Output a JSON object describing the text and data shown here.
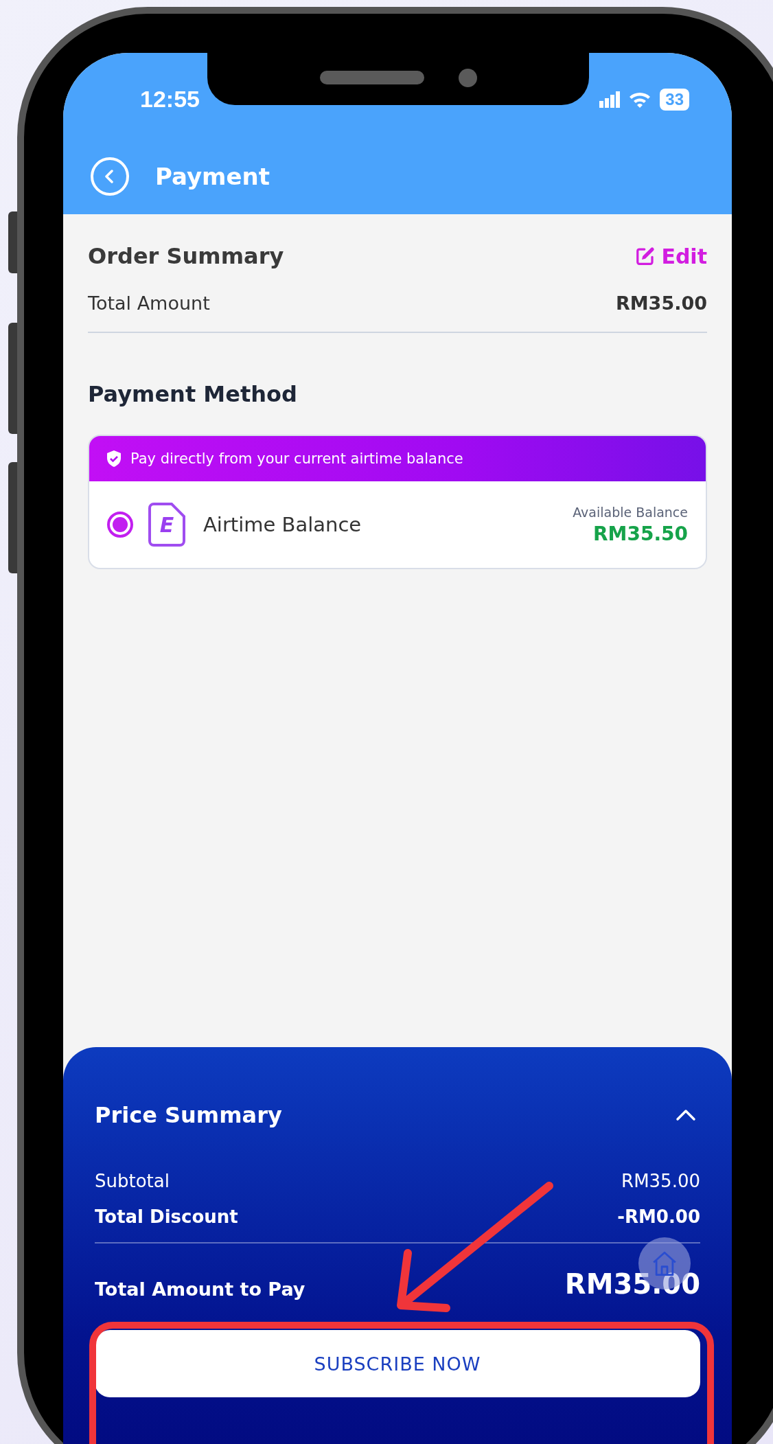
{
  "status_bar": {
    "time": "12:55",
    "battery": "33"
  },
  "header": {
    "title": "Payment"
  },
  "order_summary": {
    "title": "Order Summary",
    "edit_label": "Edit",
    "rows": [
      {
        "label": "Total Amount",
        "value": "RM35.00"
      }
    ]
  },
  "payment_method": {
    "title": "Payment Method",
    "banner": "Pay directly from your current airtime balance",
    "options": [
      {
        "icon_letter": "E",
        "name": "Airtime Balance",
        "balance_label": "Available Balance",
        "balance": "RM35.50",
        "selected": true
      }
    ]
  },
  "price_summary": {
    "title": "Price Summary",
    "expanded": true,
    "rows": [
      {
        "label": "Subtotal",
        "value": "RM35.00",
        "kind": "normal"
      },
      {
        "label": "Total Discount",
        "value": "-RM0.00",
        "kind": "bold"
      }
    ],
    "total": {
      "label": "Total Amount to Pay",
      "value": "RM35.00"
    },
    "button": "SUBSCRIBE NOW"
  }
}
